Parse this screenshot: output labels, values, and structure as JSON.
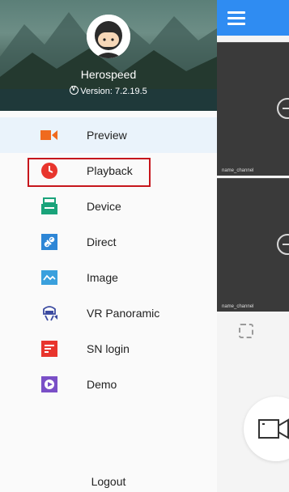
{
  "user": {
    "name": "Herospeed",
    "version": "Version: 7.2.19.5"
  },
  "menu": [
    {
      "label": "Preview",
      "icon": "camera-icon",
      "color": "#f06a1e"
    },
    {
      "label": "Playback",
      "icon": "clock-icon",
      "color": "#e8352d"
    },
    {
      "label": "Device",
      "icon": "device-icon",
      "color": "#19a37a"
    },
    {
      "label": "Direct",
      "icon": "link-icon",
      "color": "#2d86d6"
    },
    {
      "label": "Image",
      "icon": "image-icon",
      "color": "#3aa0dd"
    },
    {
      "label": "VR Panoramic",
      "icon": "vr-icon",
      "color": "#3b4aa0"
    },
    {
      "label": "SN login",
      "icon": "sn-icon",
      "color": "#e8352d"
    },
    {
      "label": "Demo",
      "icon": "play-icon",
      "color": "#7a4fc7"
    }
  ],
  "logout": "Logout",
  "main": {
    "channel_label_1": "name_channel",
    "channel_label_2": "name_channel"
  },
  "colors": {
    "topbar": "#2f8cf2",
    "highlight": "#c6161c"
  }
}
